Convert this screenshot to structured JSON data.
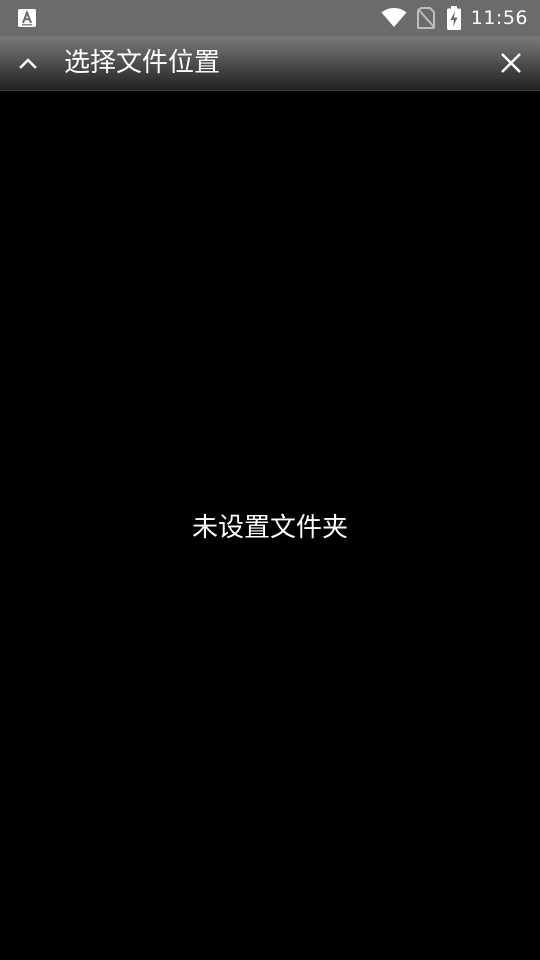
{
  "status_bar": {
    "time": "11:56",
    "icons": [
      "app-notification-icon",
      "wifi-icon",
      "no-sim-icon",
      "battery-charging-icon"
    ]
  },
  "app_bar": {
    "title": "选择文件位置",
    "left_icon": "chevron-up-icon",
    "right_icon": "close-icon"
  },
  "content": {
    "empty_message": "未设置文件夹"
  },
  "colors": {
    "background": "#000000",
    "status_bar": "#6b6b6b",
    "text": "#ffffff"
  }
}
